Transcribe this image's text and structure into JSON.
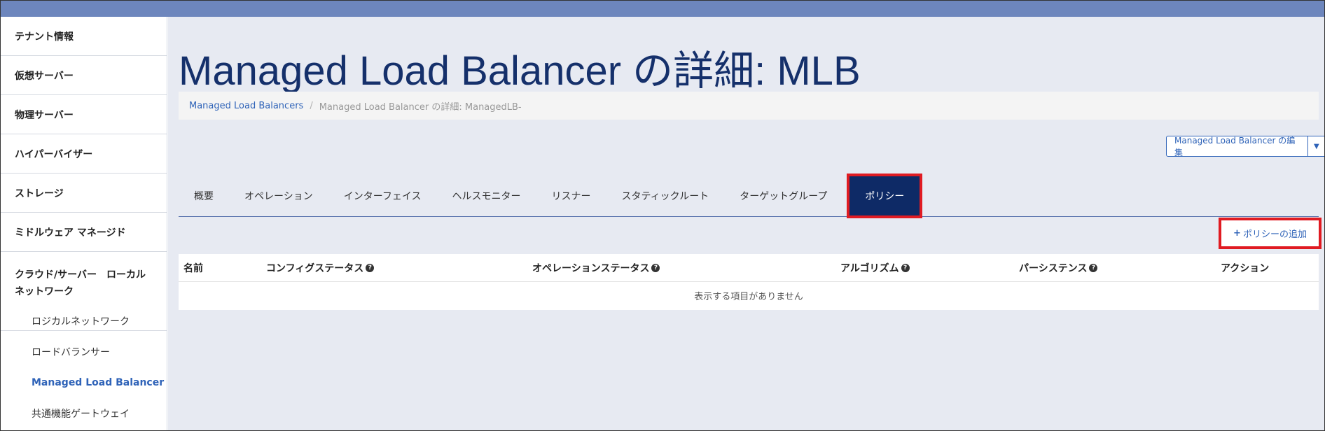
{
  "sidebar": {
    "items": [
      {
        "label": "テナント情報"
      },
      {
        "label": "仮想サーバー"
      },
      {
        "label": "物理サーバー"
      },
      {
        "label": "ハイパーバイザー"
      },
      {
        "label": "ストレージ"
      },
      {
        "label": "ミドルウェア マネージド"
      },
      {
        "label": "クラウド/サーバー　ローカルネットワーク"
      }
    ],
    "sub_items": [
      {
        "label": "ロジカルネットワーク"
      },
      {
        "label": "ロードバランサー"
      },
      {
        "label": "Managed Load Balancer",
        "active": true
      },
      {
        "label": "共通機能ゲートウェイ"
      }
    ]
  },
  "page": {
    "title": "Managed Load Balancer の詳細: MLB"
  },
  "breadcrumb": {
    "link": "Managed Load Balancers",
    "separator": "/",
    "current": "Managed Load Balancer の詳細: ManagedLB-"
  },
  "actions": {
    "edit_label": "Managed Load Balancer の編集",
    "edit_caret": "▼",
    "add_policy_label": "ポリシーの追加",
    "add_policy_icon": "+"
  },
  "tabs": [
    {
      "label": "概要"
    },
    {
      "label": "オペレーション"
    },
    {
      "label": "インターフェイス"
    },
    {
      "label": "ヘルスモニター"
    },
    {
      "label": "リスナー"
    },
    {
      "label": "スタティックルート"
    },
    {
      "label": "ターゲットグループ"
    },
    {
      "label": "ポリシー",
      "active": true
    }
  ],
  "table": {
    "headers": {
      "name": "名前",
      "config_status": "コンフィグステータス",
      "operation_status": "オペレーションステータス",
      "algorithm": "アルゴリズム",
      "persistence": "パーシステンス",
      "action": "アクション"
    },
    "help_icon": "?",
    "empty_message": "表示する項目がありません"
  },
  "colors": {
    "accent": "#2f63b8",
    "title": "#15306b",
    "active_tab": "#0e2a66",
    "highlight": "#e01b22",
    "topbar": "#6d86bd"
  }
}
